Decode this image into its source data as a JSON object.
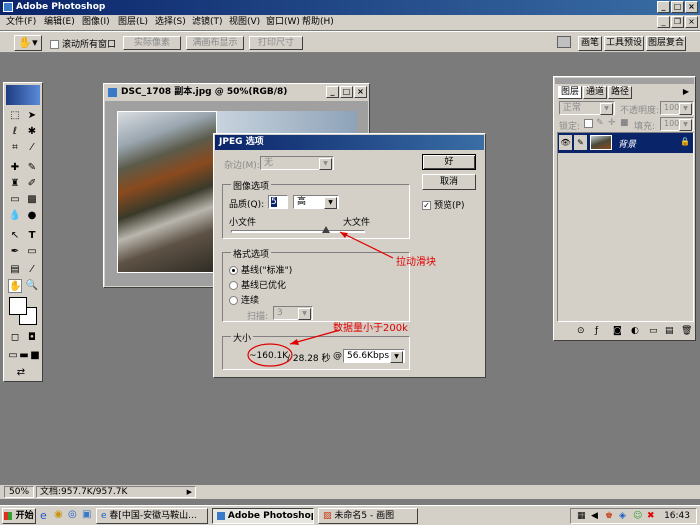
{
  "app": {
    "title": "Adobe Photoshop"
  },
  "menu": {
    "items": [
      "文件(F)",
      "编辑(E)",
      "图像(I)",
      "图层(L)",
      "选择(S)",
      "滤镜(T)",
      "视图(V)",
      "窗口(W)",
      "帮助(H)"
    ]
  },
  "options_bar": {
    "scroll_all_label": "滚动所有窗口",
    "btn_actual": "实际像素",
    "btn_fit": "满画布显示",
    "btn_print": "打印尺寸"
  },
  "right_tabs": {
    "brushes": "画笔",
    "tool_presets": "工具预设",
    "layer_comps": "图层复合"
  },
  "document": {
    "title": "DSC_1708 副本.jpg @ 50%(RGB/8)"
  },
  "jpeg_dialog": {
    "title": "JPEG 选项",
    "matte_label": "杂边(M):",
    "matte_value": "无",
    "image_options_label": "图像选项",
    "quality_label": "品质(Q):",
    "quality_value": "5",
    "quality_preset": "高",
    "small_file": "小文件",
    "large_file": "大文件",
    "quality_slider_level": 0.42,
    "format_options_label": "格式选项",
    "radio_baseline": "基线(\"标准\")",
    "radio_optimized": "基线已优化",
    "radio_progressive": "连续",
    "scans_label": "扫描:",
    "scans_value": "3",
    "size_label": "大小",
    "size_value": "~160.1K",
    "size_time": "/ 28.28 秒",
    "at_symbol": "@",
    "modem_value": "56.6Kbps",
    "ok_label": "好",
    "cancel_label": "取消",
    "preview_label": "预览(P)"
  },
  "annotations": {
    "slider_note": "拉动滑块",
    "size_note": "数据量小于200k"
  },
  "layers_panel": {
    "tab_layers": "图层",
    "tab_channels": "通道",
    "tab_paths": "路径",
    "blend_mode": "正常",
    "opacity_label": "不透明度:",
    "opacity_value": "100%",
    "lock_label": "锁定:",
    "fill_label": "填充:",
    "fill_value": "100%",
    "layer_name": "背景"
  },
  "status_bar": {
    "zoom": "50%",
    "doc_info": "文档:957.7K/957.7K"
  },
  "taskbar": {
    "start": "开始",
    "tasks": [
      "春[中国-安徽马鞍山...",
      "Adobe Photoshop",
      "未命名5 - 画图"
    ],
    "clock": "16:43"
  },
  "colors": {
    "annotation_red": "#e00000",
    "title_blue": "#0a246a"
  }
}
